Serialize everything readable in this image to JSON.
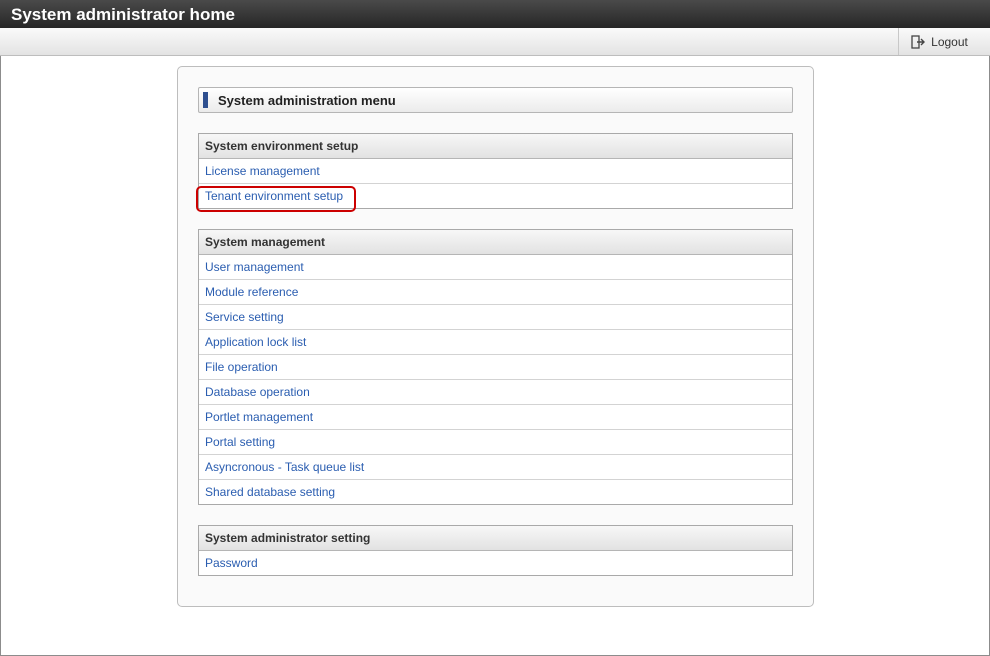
{
  "window": {
    "title": "System administrator home"
  },
  "toolbar": {
    "logout_label": "Logout",
    "logout_icon": "logout-icon"
  },
  "menu": {
    "heading": "System administration menu",
    "accent_color": "#2e4f8f",
    "link_color": "#2a5db0",
    "highlight_color": "#cc0000",
    "sections": [
      {
        "title": "System environment setup",
        "items": [
          {
            "label": "License management"
          },
          {
            "label": "Tenant environment setup",
            "highlighted": true
          }
        ]
      },
      {
        "title": "System management",
        "items": [
          {
            "label": "User management"
          },
          {
            "label": "Module reference"
          },
          {
            "label": "Service setting"
          },
          {
            "label": "Application lock list"
          },
          {
            "label": "File operation"
          },
          {
            "label": "Database operation"
          },
          {
            "label": "Portlet management"
          },
          {
            "label": "Portal setting"
          },
          {
            "label": "Asyncronous - Task queue list"
          },
          {
            "label": "Shared database setting"
          }
        ]
      },
      {
        "title": "System administrator setting",
        "items": [
          {
            "label": "Password"
          }
        ]
      }
    ]
  }
}
